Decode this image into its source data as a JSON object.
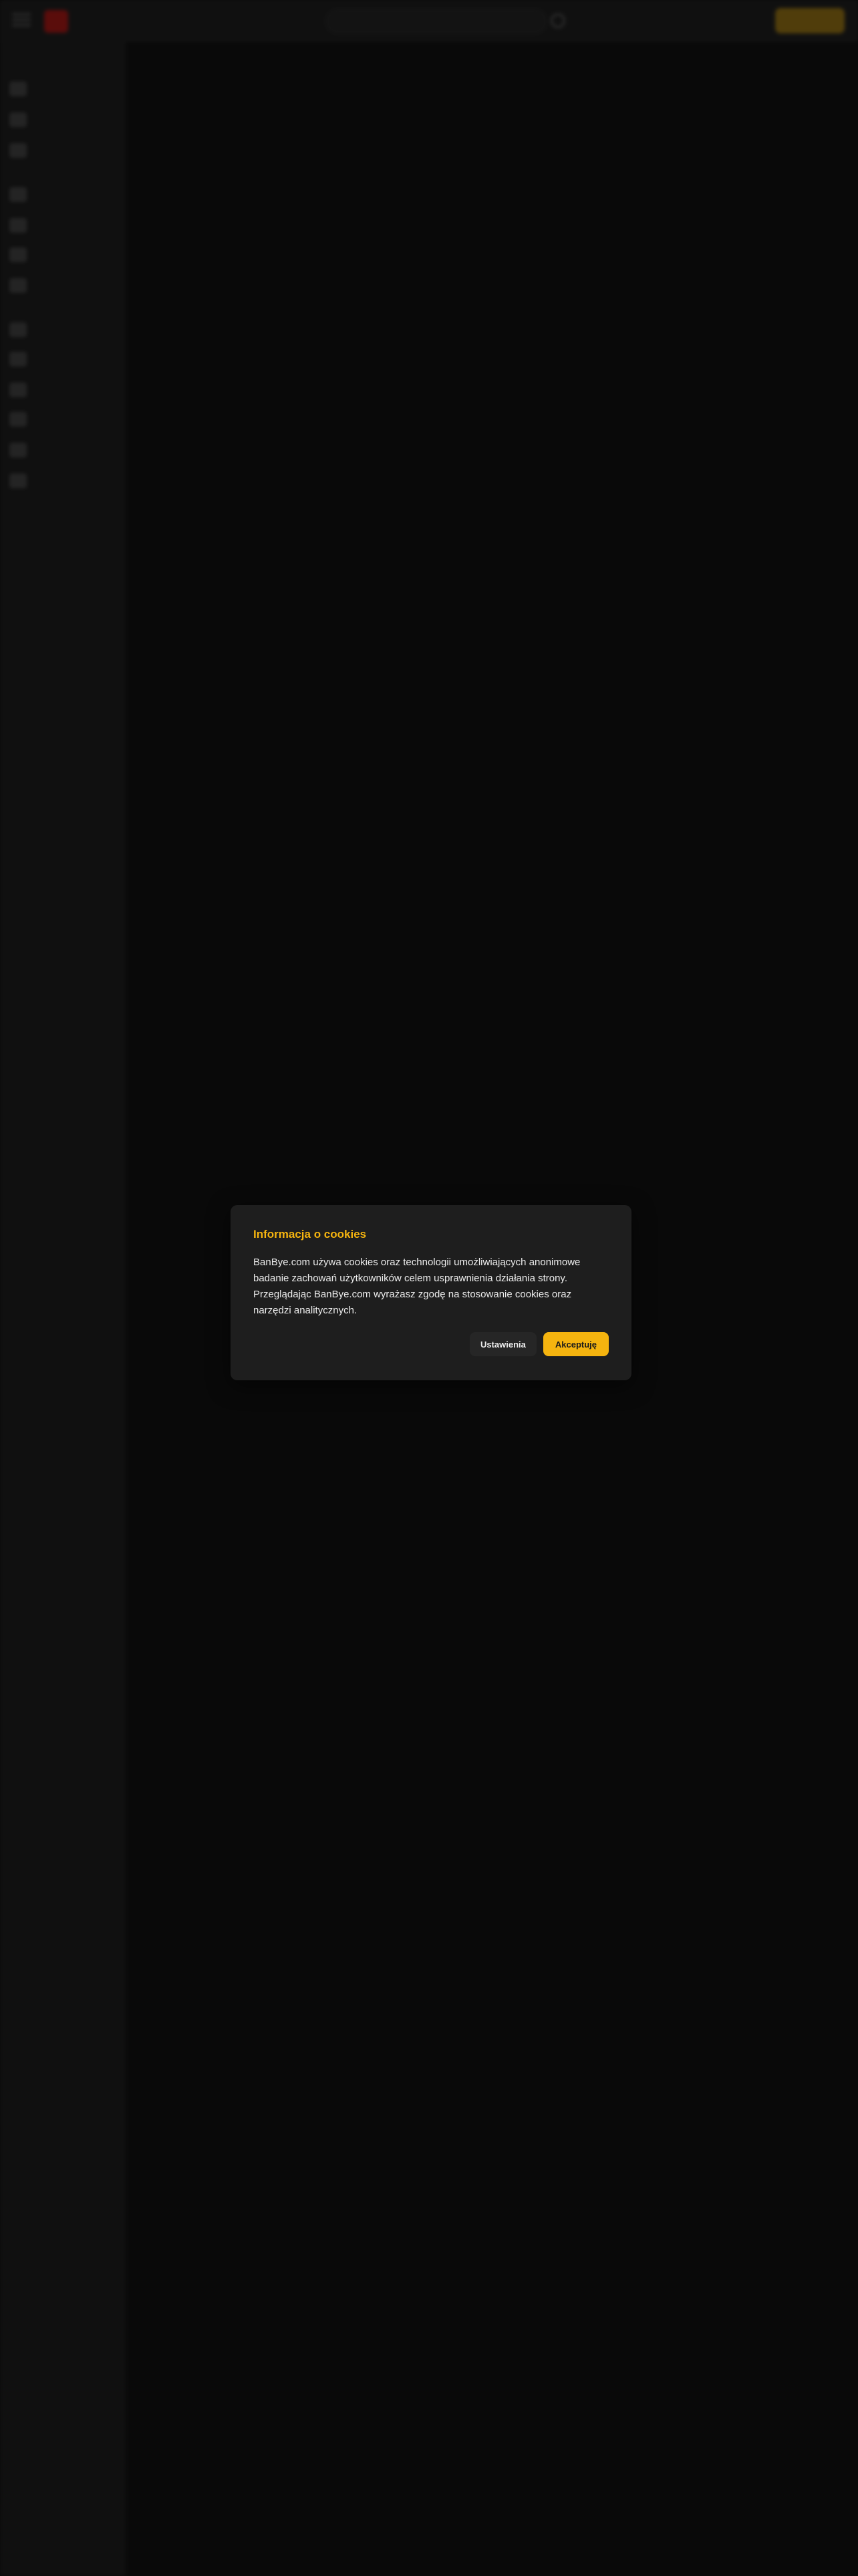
{
  "colors": {
    "page_background": "#0f0f0f",
    "dialog_background": "#1e1e1e",
    "accent": "#f5b40f",
    "brand_red": "#8a1412"
  },
  "header": {
    "menu_icon": "hamburger-icon",
    "logo_icon": "banbye-logo-icon",
    "search_icon": "search-icon"
  },
  "sidebar": {
    "item_icons": [
      "home-icon",
      "video-icon",
      "channel-icon",
      "history-icon",
      "playlist-icon",
      "like-icon",
      "clock-icon",
      "category-icon",
      "news-icon",
      "education-icon",
      "music-icon",
      "sport-icon",
      "game-icon"
    ]
  },
  "cookie_dialog": {
    "title": "Informacja o cookies",
    "body": "BanBye.com używa cookies oraz technologii umożliwiających anonimowe badanie zachowań użytkowników celem usprawnienia działania strony. Przeglądając BanBye.com wyrażasz zgodę na stosowanie cookies oraz narzędzi analitycznych.",
    "settings_label": "Ustawienia",
    "accept_label": "Akceptuję"
  }
}
